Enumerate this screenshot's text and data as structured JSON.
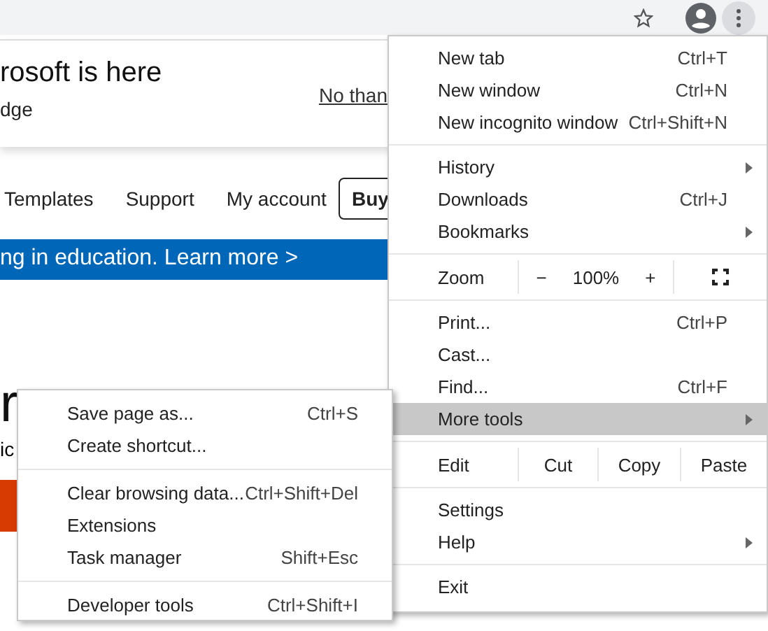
{
  "page": {
    "banner": {
      "title": "rosoft is here",
      "subtitle": "dge",
      "dismiss": "No than"
    },
    "nav": {
      "links": [
        "Templates",
        "Support",
        "My account"
      ],
      "button": "Buy"
    },
    "promo": "ng in education. Learn more >",
    "heading": "r",
    "body": "ic",
    "cta": {
      "kind": "button"
    }
  },
  "menu": {
    "sections": [
      [
        {
          "kind": "item",
          "label": "New tab",
          "shortcut": "Ctrl+T",
          "submenu": false,
          "selected": false
        },
        {
          "kind": "item",
          "label": "New window",
          "shortcut": "Ctrl+N",
          "submenu": false,
          "selected": false
        },
        {
          "kind": "item",
          "label": "New incognito window",
          "shortcut": "Ctrl+Shift+N",
          "submenu": false,
          "selected": false
        }
      ],
      [
        {
          "kind": "item",
          "label": "History",
          "submenu": true,
          "selected": false
        },
        {
          "kind": "item",
          "label": "Downloads",
          "shortcut": "Ctrl+J",
          "submenu": false,
          "selected": false
        },
        {
          "kind": "item",
          "label": "Bookmarks",
          "submenu": true,
          "selected": false
        }
      ],
      [
        {
          "kind": "zoom",
          "label": "Zoom",
          "minus": "−",
          "value": "100%",
          "plus": "+"
        }
      ],
      [
        {
          "kind": "item",
          "label": "Print...",
          "shortcut": "Ctrl+P",
          "submenu": false,
          "selected": false
        },
        {
          "kind": "item",
          "label": "Cast...",
          "submenu": false,
          "selected": false
        },
        {
          "kind": "item",
          "label": "Find...",
          "shortcut": "Ctrl+F",
          "submenu": false,
          "selected": false
        },
        {
          "kind": "item",
          "label": "More tools",
          "submenu": true,
          "selected": true
        }
      ],
      [
        {
          "kind": "edit",
          "label": "Edit",
          "actions": [
            "Cut",
            "Copy",
            "Paste"
          ]
        }
      ],
      [
        {
          "kind": "item",
          "label": "Settings",
          "submenu": false,
          "selected": false
        },
        {
          "kind": "item",
          "label": "Help",
          "submenu": true,
          "selected": false
        }
      ],
      [
        {
          "kind": "item",
          "label": "Exit",
          "submenu": false,
          "selected": false
        }
      ]
    ]
  },
  "submenu": {
    "sections": [
      [
        {
          "label": "Save page as...",
          "shortcut": "Ctrl+S"
        },
        {
          "label": "Create shortcut..."
        }
      ],
      [
        {
          "label": "Clear browsing data...",
          "shortcut": "Ctrl+Shift+Del"
        },
        {
          "label": "Extensions"
        },
        {
          "label": "Task manager",
          "shortcut": "Shift+Esc"
        }
      ],
      [
        {
          "label": "Developer tools",
          "shortcut": "Ctrl+Shift+I"
        }
      ]
    ]
  }
}
